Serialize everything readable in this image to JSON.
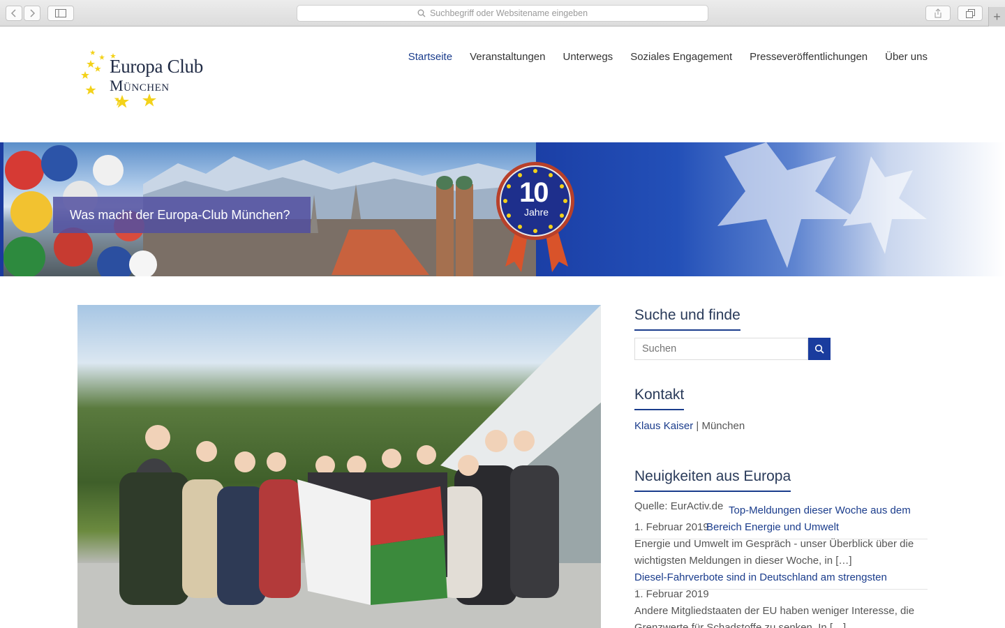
{
  "browser": {
    "address_placeholder": "Suchbegriff oder Websitename eingeben"
  },
  "logo": {
    "line1": "Europa Club",
    "line2": "München"
  },
  "nav": [
    {
      "label": "Startseite",
      "active": true
    },
    {
      "label": "Veranstaltungen"
    },
    {
      "label": "Unterwegs"
    },
    {
      "label": "Soziales Engagement"
    },
    {
      "label": "Presseveröffentlichungen"
    },
    {
      "label": "Über uns"
    }
  ],
  "banner": {
    "cta": "Was macht der Europa-Club München?",
    "badge_number": "10",
    "badge_text": "Jahre"
  },
  "sidebar": {
    "search_title": "Suche und finde",
    "search_placeholder": "Suchen",
    "contact_title": "Kontakt",
    "contact_name": "Klaus Kaiser",
    "contact_sep": " | ",
    "contact_city": "München",
    "news_title": "Neuigkeiten aus Europa",
    "news_source": "Quelle: EurActiv.de",
    "news": [
      {
        "title_a": "Top-Meldungen dieser Woche aus dem",
        "title_b": "Bereich Energie und Umwelt",
        "date": "1. Februar 2019",
        "excerpt_a": "Energie und Umwelt im Gespräch - unser Überblick über die",
        "excerpt_b": "wichtigsten Meldungen in dieser Woche, in […]"
      },
      {
        "title_a": "Diesel-Fahrverbote sind in Deutschland am strengsten",
        "date": "1. Februar 2019",
        "excerpt_a": "Andere Mitgliedstaaten der EU haben weniger Interesse, die",
        "excerpt_b": "Grenzwerte für Schadstoffe zu senken. In […]"
      }
    ]
  },
  "colors": {
    "brand_blue": "#1a3c8c",
    "button_blue": "#1a3c9e",
    "cta_purple": "#52509f",
    "star_yellow": "#f3d21a"
  }
}
